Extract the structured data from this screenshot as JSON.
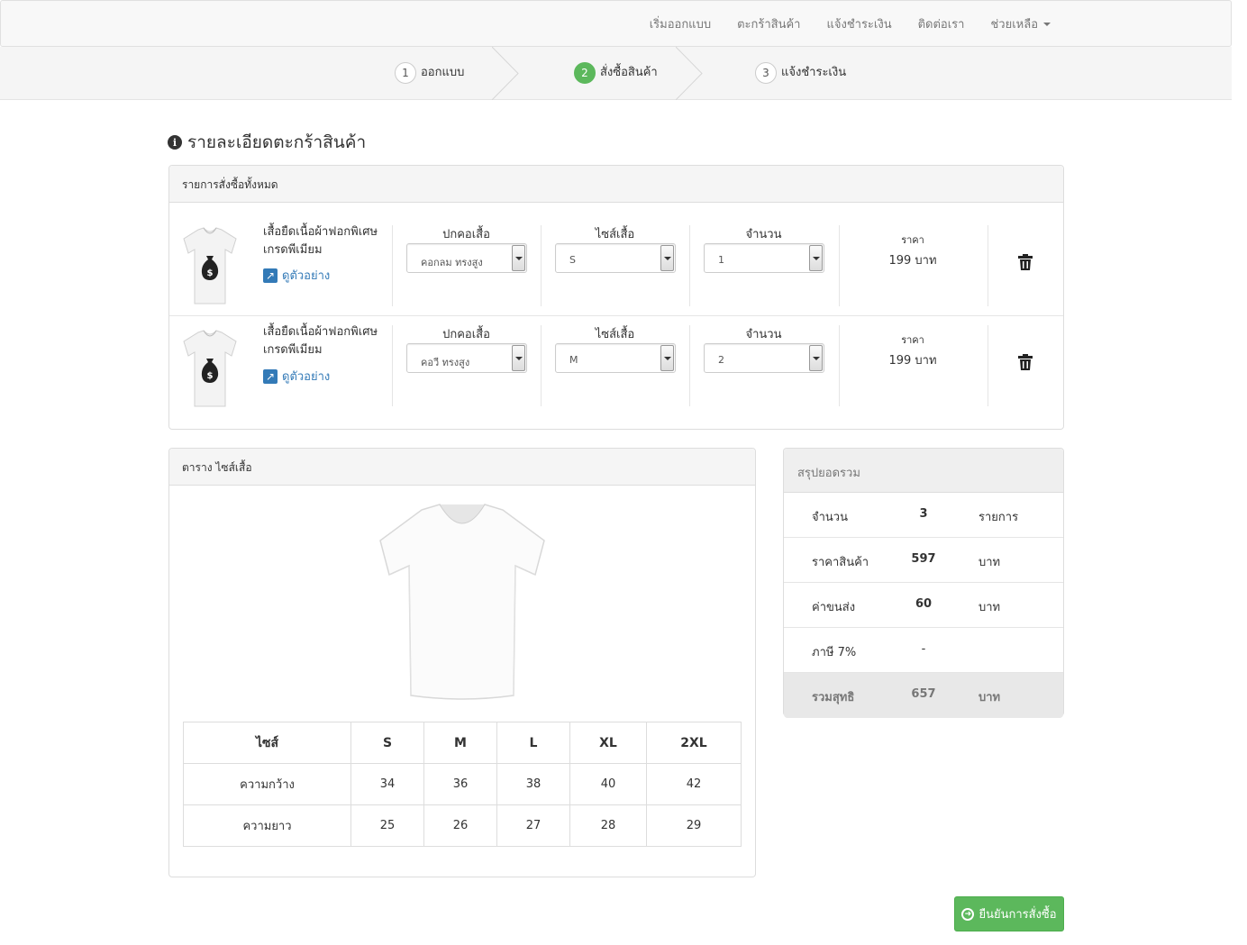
{
  "nav": {
    "items": [
      "เริ่มออกแบบ",
      "ตะกร้าสินค้า",
      "แจ้งชำระเงิน",
      "ติดต่อเรา",
      "ช่วยเหลือ"
    ]
  },
  "wizard": {
    "steps": [
      {
        "num": "1",
        "label": "ออกแบบ"
      },
      {
        "num": "2",
        "label": "สั่งซื้อสินค้า"
      },
      {
        "num": "3",
        "label": "แจ้งชำระเงิน"
      }
    ],
    "active_step": 2
  },
  "page_title": "รายละเอียดตะกร้าสินค้า",
  "cart": {
    "heading": "รายการสั่งซื้อทั้งหมด",
    "collar_label": "ปกคอเสื้อ",
    "size_label": "ไซส์เสื้อ",
    "qty_label": "จำนวน",
    "price_label": "ราคา",
    "items": [
      {
        "name": "เสื้อยืดเนื้อผ้าฟอกพิเศษ เกรดพีเมียม",
        "view_link": "ดูตัวอย่าง",
        "collar": "คอกลม ทรงสูง",
        "size": "S",
        "qty": "1",
        "price": "199 บาท"
      },
      {
        "name": "เสื้อยืดเนื้อผ้าฟอกพิเศษ เกรดพีเมียม",
        "view_link": "ดูตัวอย่าง",
        "collar": "คอวี ทรงสูง",
        "size": "M",
        "qty": "2",
        "price": "199 บาท"
      }
    ]
  },
  "size_chart": {
    "heading": "ตาราง ไซส์เสื้อ",
    "headers": [
      "ไซส์",
      "S",
      "M",
      "L",
      "XL",
      "2XL"
    ],
    "rows": [
      [
        "ความกว้าง",
        "34",
        "36",
        "38",
        "40",
        "42"
      ],
      [
        "ความยาว",
        "25",
        "26",
        "27",
        "28",
        "29"
      ]
    ]
  },
  "summary": {
    "heading": "สรุปยอดรวม",
    "rows": [
      {
        "key": "จำนวน",
        "value": "3",
        "unit": "รายการ"
      },
      {
        "key": "ราคาสินค้า",
        "value": "597",
        "unit": "บาท"
      },
      {
        "key": "ค่าขนส่ง",
        "value": "60",
        "unit": "บาท"
      },
      {
        "key": "ภาษี 7%",
        "value": "-",
        "unit": ""
      }
    ],
    "total": {
      "key": "รวมสุทธิ",
      "value": "657",
      "unit": "บาท"
    }
  },
  "confirm_button": "ยืนยันการสั่งซื้อ",
  "colors": {
    "accent_green": "#5cb85c",
    "link_blue": "#337ab7"
  }
}
